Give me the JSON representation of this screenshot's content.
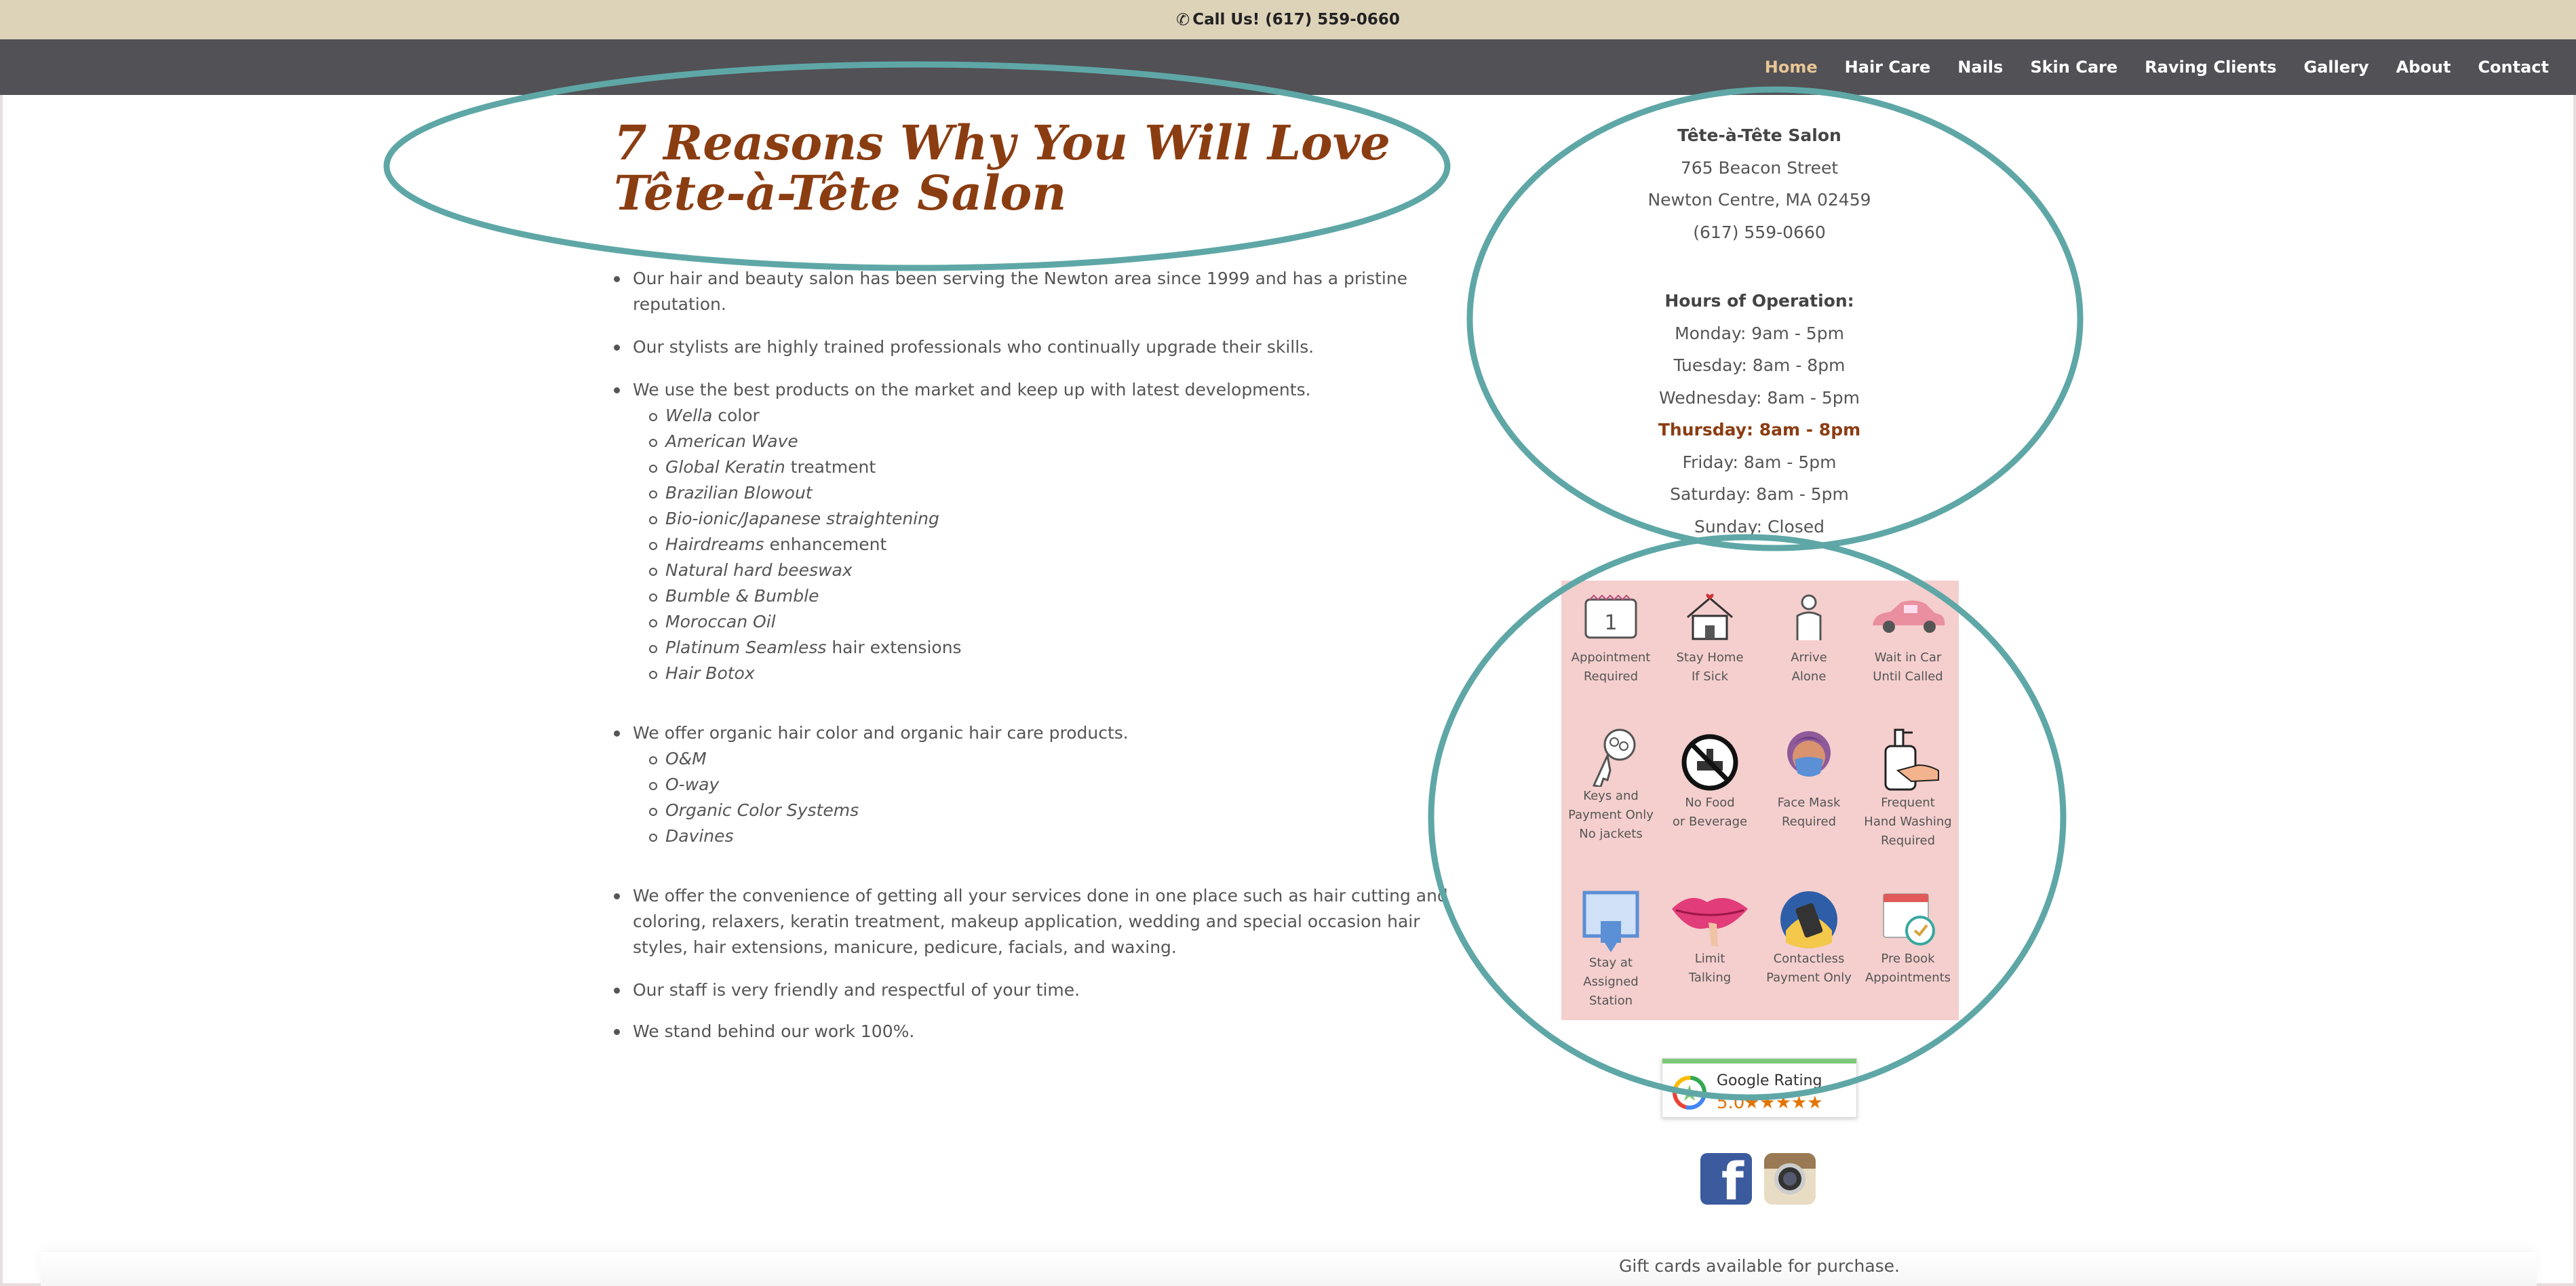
{
  "topbar": {
    "phone_text": "Call Us! (617) 559-0660"
  },
  "nav": {
    "items": [
      {
        "label": "Home"
      },
      {
        "label": "Hair Care"
      },
      {
        "label": "Nails"
      },
      {
        "label": "Skin Care"
      },
      {
        "label": "Raving Clients"
      },
      {
        "label": "Gallery"
      },
      {
        "label": "About"
      },
      {
        "label": "Contact"
      }
    ],
    "active_color": "#e8c796"
  },
  "main": {
    "title": "7 Reasons Why You Will Love Tête-à-Tête Salon",
    "bullets": [
      "Our hair and beauty salon has been serving the Newton area since 1999 and has a pristine reputation.",
      "Our stylists are highly trained professionals who continually upgrade their skills.",
      "We use the best products on the market and keep up with latest developments.",
      "We offer organic hair color and organic hair care products.",
      "We offer the convenience of getting all your services done in one place such as hair cutting and coloring, relaxers, keratin treatment, makeup application, wedding and special occasion hair styles, hair extensions, manicure, pedicure, facials, and waxing.",
      "Our staff is very friendly and respectful of your time.",
      "We stand behind our work 100%."
    ],
    "products": [
      {
        "brand": "Wella",
        "suffix": " color"
      },
      {
        "brand": "American Wave",
        "suffix": ""
      },
      {
        "brand": "Global Keratin",
        "suffix": " treatment"
      },
      {
        "brand": "Brazilian Blowout",
        "suffix": ""
      },
      {
        "brand": "Bio-ionic/Japanese straightening",
        "suffix": ""
      },
      {
        "brand": "Hairdreams",
        "suffix": " enhancement"
      },
      {
        "brand": "Natural hard beeswax",
        "suffix": ""
      },
      {
        "brand": "Bumble & Bumble",
        "suffix": ""
      },
      {
        "brand": "Moroccan Oil",
        "suffix": ""
      },
      {
        "brand": "Platinum Seamless",
        "suffix": " hair extensions"
      },
      {
        "brand": "Hair Botox",
        "suffix": ""
      }
    ],
    "organic": [
      "O&M",
      "O-way",
      "Organic Color Systems",
      "Davines"
    ],
    "title_color": "#8b3d12"
  },
  "sidebar": {
    "name": "Tête-à-Tête Salon",
    "street": "765 Beacon Street",
    "city": "Newton Centre, MA 02459",
    "phone": "(617) 559-0660",
    "hours_heading": "Hours of Operation:",
    "hours": [
      "Monday: 9am - 5pm",
      "Tuesday: 8am - 8pm",
      "Wednesday: 8am - 5pm",
      "Thursday: 8am - 8pm",
      "Friday: 8am - 5pm",
      "Saturday: 8am - 5pm",
      "Sunday: Closed"
    ],
    "today_index": 3,
    "covid_rules": [
      {
        "label1": "Appointment",
        "label2": "Required",
        "label3": "",
        "icon": "calendar-icon"
      },
      {
        "label1": "Stay Home",
        "label2": "If Sick",
        "label3": "",
        "icon": "house-icon"
      },
      {
        "label1": "Arrive",
        "label2": "Alone",
        "label3": "",
        "icon": "person-icon"
      },
      {
        "label1": "Wait in Car",
        "label2": "Until Called",
        "label3": "",
        "icon": "car-icon"
      },
      {
        "label1": "Keys and",
        "label2": "Payment Only",
        "label3": "No jackets",
        "icon": "keys-icon"
      },
      {
        "label1": "No Food",
        "label2": "or Beverage",
        "label3": "",
        "icon": "no-food-icon"
      },
      {
        "label1": "Face Mask",
        "label2": "Required",
        "label3": "",
        "icon": "face-mask-icon"
      },
      {
        "label1": "Frequent",
        "label2": "Hand Washing",
        "label3": "Required",
        "icon": "hand-wash-icon"
      },
      {
        "label1": "Stay at Assigned",
        "label2": "Station",
        "label3": "",
        "icon": "station-icon"
      },
      {
        "label1": "Limit",
        "label2": "Talking",
        "label3": "",
        "icon": "lips-icon"
      },
      {
        "label1": "Contactless",
        "label2": "Payment Only",
        "label3": "",
        "icon": "card-icon"
      },
      {
        "label1": "Pre Book",
        "label2": "Appointments",
        "label3": "",
        "icon": "calendar-clock-icon"
      }
    ],
    "google_label": "Google Rating",
    "google_score": "5.0",
    "gift_text": "Gift cards available for purchase."
  }
}
